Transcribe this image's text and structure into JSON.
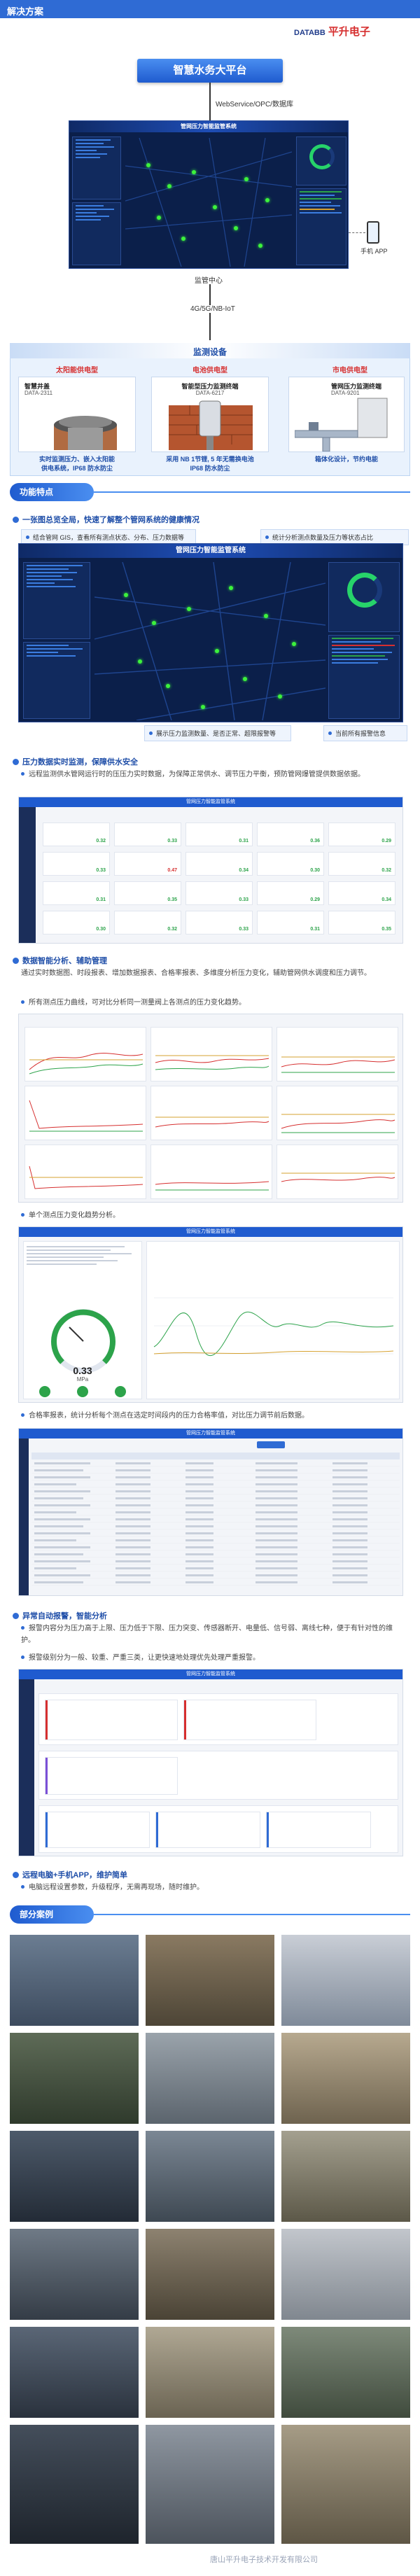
{
  "header": {
    "section_title": "解决方案",
    "brand_en": "DATABB",
    "brand_cn": "平升电子"
  },
  "platform": {
    "title": "智慧水务大平台",
    "service_label": "WebService/OPC/数据库"
  },
  "dashboard": {
    "title": "管网压力智能监管系统"
  },
  "network": {
    "center_label": "监管中心",
    "link_label": "4G/5G/NB-IoT",
    "mobile_label": "手机 APP"
  },
  "monitoring": {
    "title": "监测设备",
    "devices": [
      {
        "type": "太阳能供电型",
        "name": "智慧井盖",
        "model": "DATA-2311",
        "caption_1": "实时监测压力、嵌入太阳能",
        "caption_2": "供电系统，IP68 防水防尘"
      },
      {
        "type": "电池供电型",
        "name": "智能型压力监测终端",
        "model": "DATA-6217",
        "caption_1": "采用 NB 1节锂, 5 年无需换电池",
        "caption_2": "IP68 防水防尘"
      },
      {
        "type": "市电供电型",
        "name": "管网压力监测终端",
        "model": "DATA-9201",
        "caption_1": "箱体化设计，节约电能",
        "caption_2": ""
      }
    ]
  },
  "features": {
    "pill": "功能特点",
    "f1": {
      "heading": "一张图总览全局，快速了解整个管网系统的健康情况",
      "b1": "结合管网 GIS，查看所有测点状态、分布、压力数据等",
      "b2": "统计分析测点数量及压力等状态占比",
      "c1": "展示压力监测数量、是否正常、超限报警等",
      "c2": "当前所有报警信息",
      "screen_title": "管网压力智能监管系统"
    },
    "f2": {
      "heading": "压力数据实时监测，保障供水安全",
      "text": "远程监测供水管网运行时的压压力实时数据，为保障正常供水、调节压力平衡，预防管网爆管提供数据依据。",
      "screen_title": "管网压力智能监管系统"
    },
    "f3": {
      "heading": "数据智能分析、辅助管理",
      "text1": "通过实时数据图、时段报表、增加数据报表、合格率报表、多维度分析压力变化，辅助管网供水调度和压力调节。",
      "b1": "所有测点压力曲线，可对比分析同一测量阀上各测点的压力变化趋势。",
      "b2": "单个测点压力变化趋势分析。",
      "b3": "合格率报表，统计分析每个测点在选定时间段内的压力合格率值，对比压力调节前后数据。",
      "gauge_value": "0.33",
      "gauge_unit": "MPa"
    },
    "f4": {
      "heading": "异常自动报警，智能分析",
      "b1": "报警内容分为压力高于上限、压力低于下限、压力突变、传感器断开、电量低、信号弱、离线七种，便于有针对性的维护。",
      "b2": "报警级别分为一般、较重、严重三类，让更快速地处理优先处理严重报警。"
    },
    "f5": {
      "heading": "远程电脑+手机APP，维护简单",
      "b1": "电脑远程设置参数，升级程序，无需再现场，随时维护。"
    }
  },
  "cases": {
    "pill": "部分案例"
  },
  "watermark": "唐山平升电子技术开发有限公司"
}
